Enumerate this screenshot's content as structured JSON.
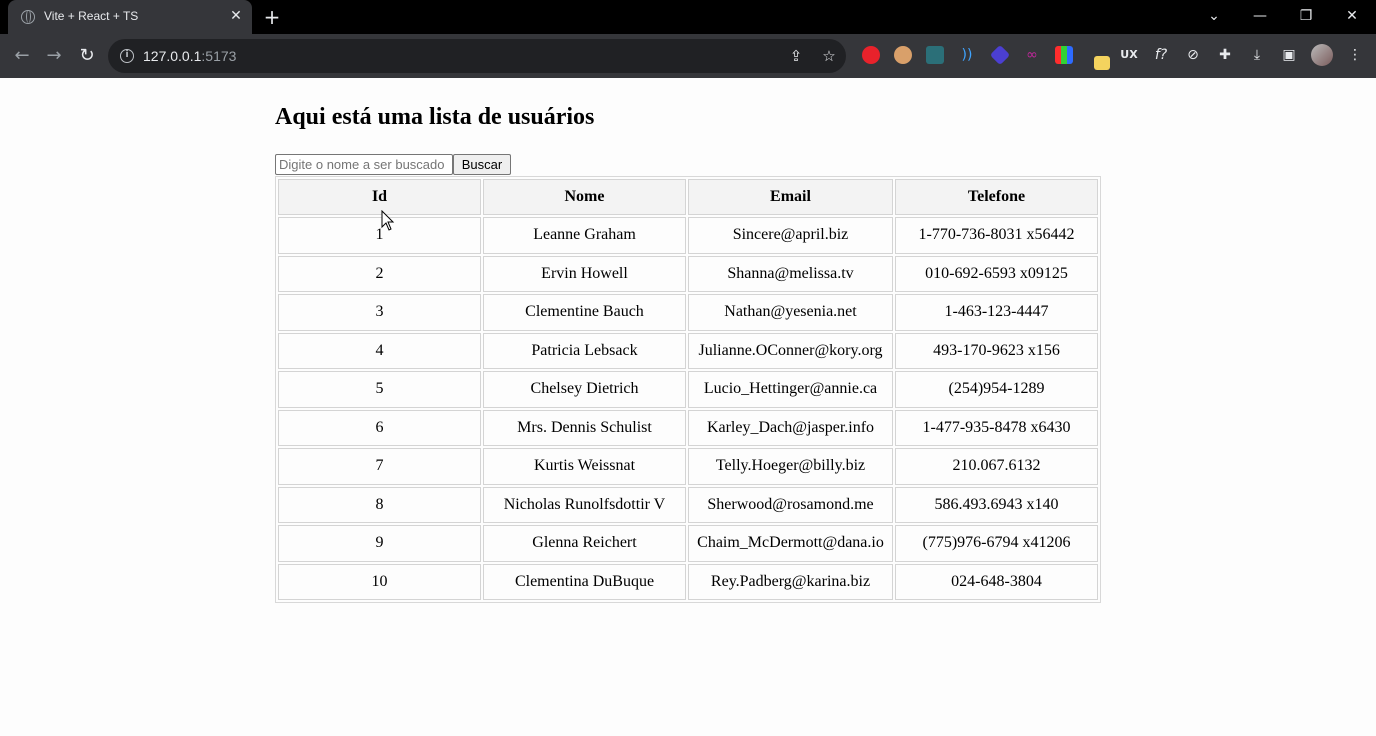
{
  "browser": {
    "tab_title": "Vite + React + TS",
    "tab_close": "✕",
    "new_tab": "+",
    "url_host": "127.0.0.1",
    "url_port": ":5173",
    "window_controls": {
      "dropdown": "⌄",
      "minimize": "—",
      "restore": "❐",
      "close": "✕"
    }
  },
  "page": {
    "title": "Aqui está uma lista de usuários",
    "search_placeholder": "Digite o nome a ser buscado",
    "search_value": "",
    "search_button": "Buscar"
  },
  "table": {
    "headers": [
      "Id",
      "Nome",
      "Email",
      "Telefone"
    ],
    "rows": [
      [
        "1",
        "Leanne Graham",
        "Sincere@april.biz",
        "1-770-736-8031 x56442"
      ],
      [
        "2",
        "Ervin Howell",
        "Shanna@melissa.tv",
        "010-692-6593 x09125"
      ],
      [
        "3",
        "Clementine Bauch",
        "Nathan@yesenia.net",
        "1-463-123-4447"
      ],
      [
        "4",
        "Patricia Lebsack",
        "Julianne.OConner@kory.org",
        "493-170-9623 x156"
      ],
      [
        "5",
        "Chelsey Dietrich",
        "Lucio_Hettinger@annie.ca",
        "(254)954-1289"
      ],
      [
        "6",
        "Mrs. Dennis Schulist",
        "Karley_Dach@jasper.info",
        "1-477-935-8478 x6430"
      ],
      [
        "7",
        "Kurtis Weissnat",
        "Telly.Hoeger@billy.biz",
        "210.067.6132"
      ],
      [
        "8",
        "Nicholas Runolfsdottir V",
        "Sherwood@rosamond.me",
        "586.493.6943 x140"
      ],
      [
        "9",
        "Glenna Reichert",
        "Chaim_McDermott@dana.io",
        "(775)976-6794 x41206"
      ],
      [
        "10",
        "Clementina DuBuque",
        "Rey.Padberg@karina.biz",
        "024-648-3804"
      ]
    ]
  },
  "colors": {
    "tabbar": "#000000",
    "toolbar": "#35363a",
    "omnibox": "#202124",
    "page_bg": "#fdfdfd"
  }
}
